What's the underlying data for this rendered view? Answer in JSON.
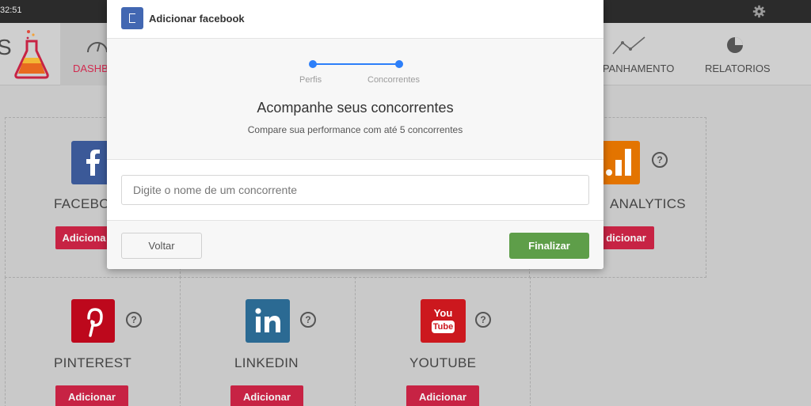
{
  "topbar": {
    "clock": "32:51"
  },
  "nav": {
    "brand_partial": "S",
    "dashboard_label": "DASHB",
    "acompanhamento_label": "MPANHAMENTO",
    "relatorios_label": "RELATORIOS"
  },
  "cards": {
    "facebook": {
      "name": "FACEBO",
      "add_label": "Adiciona"
    },
    "analytics": {
      "name": "ANALYTICS",
      "add_label": "dicionar"
    },
    "pinterest": {
      "name": "PINTEREST",
      "add_label": "Adicionar"
    },
    "linkedin": {
      "name": "LINKEDIN",
      "add_label": "Adicionar"
    },
    "youtube": {
      "name": "YOUTUBE",
      "add_label": "Adicionar",
      "icon_top": "You",
      "icon_bottom": "Tube"
    },
    "help_glyph": "?"
  },
  "modal": {
    "title": "Adicionar facebook",
    "steps": [
      "Perfis",
      "Concorrentes"
    ],
    "heading": "Acompanhe seus concorrentes",
    "subheading": "Compare sua performance com até 5 concorrentes",
    "input_placeholder": "Digite o nome de um concorrente",
    "back_label": "Voltar",
    "finish_label": "Finalizar"
  },
  "colors": {
    "accent_red": "#c72344",
    "step_blue": "#2d7ff9",
    "finish_green": "#5e9e49",
    "facebook_blue": "#3b5998",
    "pinterest_red": "#bd081c",
    "linkedin_blue": "#2b6a93",
    "youtube_red": "#cc181e",
    "analytics_orange": "#e37400"
  }
}
